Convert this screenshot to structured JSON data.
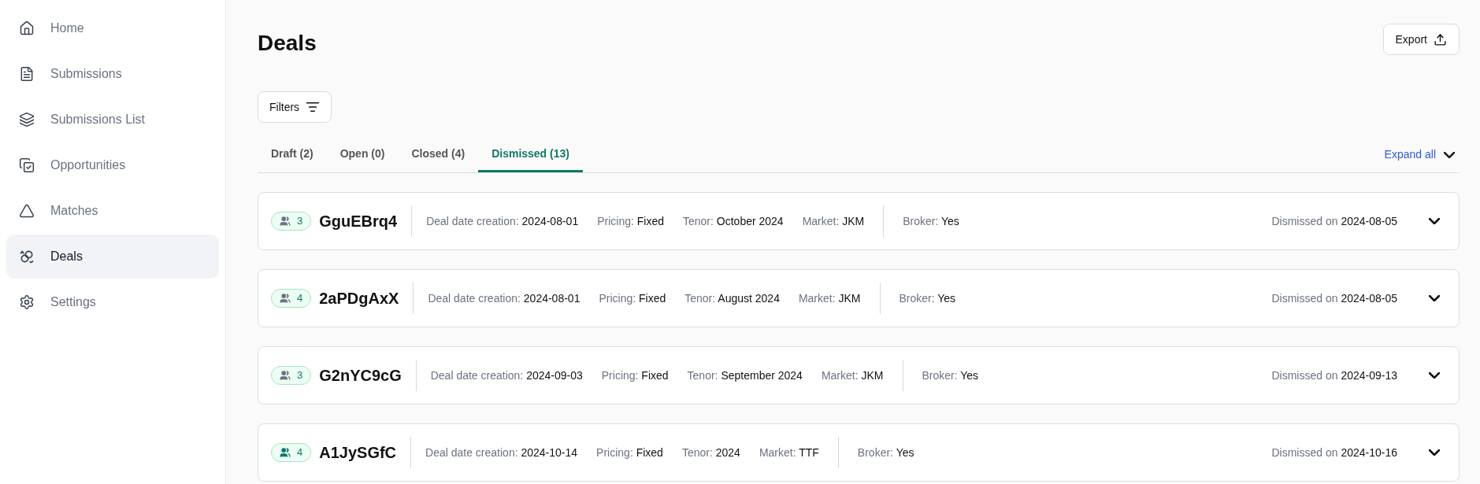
{
  "sidebar": {
    "items": [
      {
        "label": "Home",
        "selected": false
      },
      {
        "label": "Submissions",
        "selected": false
      },
      {
        "label": "Submissions List",
        "selected": false
      },
      {
        "label": "Opportunities",
        "selected": false
      },
      {
        "label": "Matches",
        "selected": false
      },
      {
        "label": "Deals",
        "selected": true
      },
      {
        "label": "Settings",
        "selected": false
      }
    ]
  },
  "header": {
    "title": "Deals",
    "export_button": "Export"
  },
  "filters_button": "Filters",
  "tabs": [
    {
      "label": "Draft (2)",
      "selected": false
    },
    {
      "label": "Open (0)",
      "selected": false
    },
    {
      "label": "Closed (4)",
      "selected": false
    },
    {
      "label": "Dismissed (13)",
      "selected": true
    }
  ],
  "expand_all": "Expand all",
  "deals": [
    {
      "count": "3",
      "color": "#6b7280",
      "id": "GguEBrq4",
      "fields": [
        {
          "label": "Deal date creation:",
          "value": "2024-08-01"
        },
        {
          "label": "Pricing:",
          "value": "Fixed"
        },
        {
          "label": "Tenor:",
          "value": "October 2024"
        },
        {
          "label": "Market:",
          "value": "JKM"
        }
      ],
      "broker": {
        "label": "Broker:",
        "value": "Yes"
      },
      "dismissed": {
        "label": "Dismissed on",
        "value": "2024-08-05"
      },
      "expanded": false
    },
    {
      "count": "4",
      "color": "#6b7280",
      "id": "2aPDgAxX",
      "fields": [
        {
          "label": "Deal date creation:",
          "value": "2024-08-01"
        },
        {
          "label": "Pricing:",
          "value": "Fixed"
        },
        {
          "label": "Tenor:",
          "value": "August 2024"
        },
        {
          "label": "Market:",
          "value": "JKM"
        }
      ],
      "broker": {
        "label": "Broker:",
        "value": "Yes"
      },
      "dismissed": {
        "label": "Dismissed on",
        "value": "2024-08-05"
      },
      "expanded": false
    },
    {
      "count": "3",
      "color": "#6b7280",
      "id": "G2nYC9cG",
      "fields": [
        {
          "label": "Deal date creation:",
          "value": "2024-09-03"
        },
        {
          "label": "Pricing:",
          "value": "Fixed"
        },
        {
          "label": "Tenor:",
          "value": "September 2024"
        },
        {
          "label": "Market:",
          "value": "JKM"
        }
      ],
      "broker": {
        "label": "Broker:",
        "value": "Yes"
      },
      "dismissed": {
        "label": "Dismissed on",
        "value": "2024-09-13"
      },
      "expanded": false
    },
    {
      "count": "4",
      "color": "#0f766e",
      "id": "A1JySGfC",
      "fields": [
        {
          "label": "Deal date creation:",
          "value": "2024-10-14"
        },
        {
          "label": "Pricing:",
          "value": "Fixed"
        },
        {
          "label": "Tenor:",
          "value": "2024"
        },
        {
          "label": "Market:",
          "value": "TTF"
        }
      ],
      "broker": {
        "label": "Broker:",
        "value": "Yes"
      },
      "dismissed": {
        "label": "Dismissed on",
        "value": "2024-10-16"
      },
      "expanded": false
    }
  ]
}
